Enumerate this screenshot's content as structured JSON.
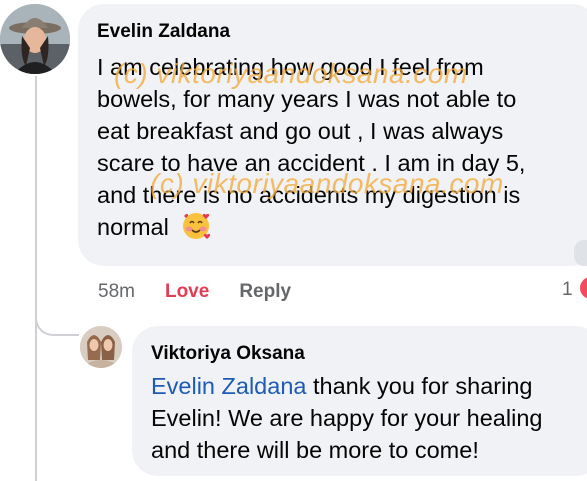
{
  "comment": {
    "author": "Evelin Zaldana",
    "text": "I am celebrating how good I feel from\nbowels, for many years I was not able to\neat breakfast and go out , I was always\nscare to have an accident . I am in day 5,\nand there is no accidents my digestion is\nnormal",
    "emoji_icon": "smiling-face-with-hearts-icon",
    "time": "58m",
    "love_label": "Love",
    "reply_label": "Reply",
    "reaction_count": "1",
    "reaction_icon": "heart-reaction-icon"
  },
  "reply": {
    "author": "Viktoriya Oksana",
    "mention": "Evelin Zaldana",
    "text": " thank you for sharing\nEvelin! We are happy for your healing\nand there will be more to come!"
  },
  "watermark": {
    "text": "(c) viktoriyaandoksana.com"
  },
  "colors": {
    "bubble": "#f0f2f5",
    "mention": "#1d5bb6",
    "love": "#e43d55",
    "meta": "#65676b",
    "watermark": "#f4aa3c"
  }
}
